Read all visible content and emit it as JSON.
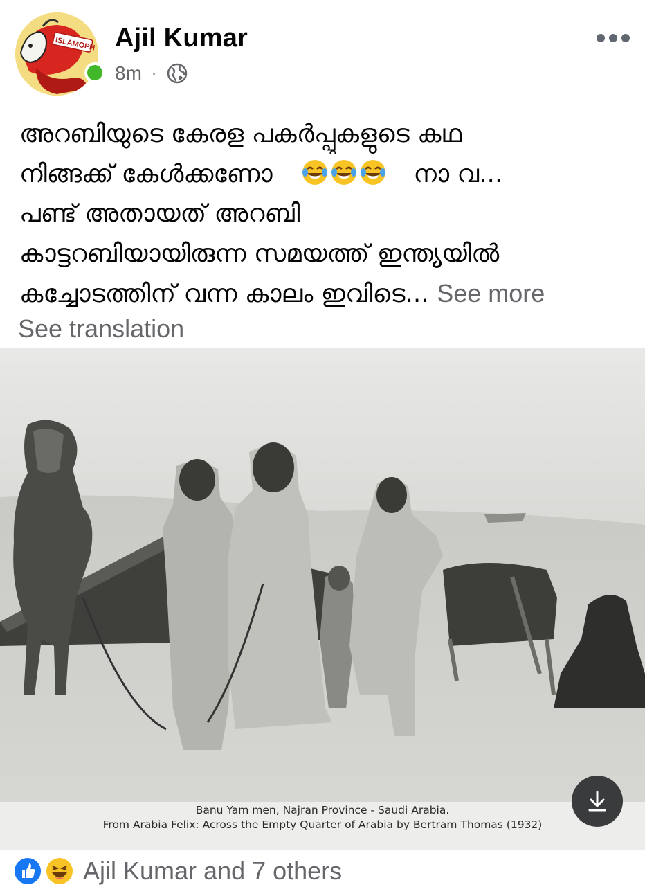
{
  "post": {
    "author": "Ajil Kumar",
    "time": "8m",
    "separator": "·",
    "avatar_text": "ISLAMOPH",
    "text_lines": [
      "അറബിയുടെ കേരള പകർപ്പുകളുടെ കഥ",
      "നിങ്ങക്ക് കേൾക്കണോ",
      "നാ വ...",
      "പണ്ട് അതായത് അറബി",
      "കാട്ടറബിയായിരുന്ന സമയത്ത് ഇന്ത്യയിൽ",
      "കച്ചോടത്തിന് വന്ന കാലം  ഇവിടെ..."
    ],
    "see_more": "See more",
    "see_translation": "See translation"
  },
  "photo": {
    "caption_line1": "Banu Yam men, Najran Province - Saudi Arabia.",
    "caption_line2": "From Arabia Felix: Across the Empty Quarter of Arabia by Bertram Thomas (1932)"
  },
  "reactions": {
    "text": "Ajil Kumar and 7 others",
    "icons": [
      "like-icon",
      "haha-icon"
    ]
  },
  "icons": {
    "globe": "globe-icon",
    "more": "more-options-icon",
    "download": "download-icon"
  },
  "colors": {
    "online": "#42b72a",
    "secondary_text": "#65676b",
    "like_blue": "#1877f2"
  }
}
